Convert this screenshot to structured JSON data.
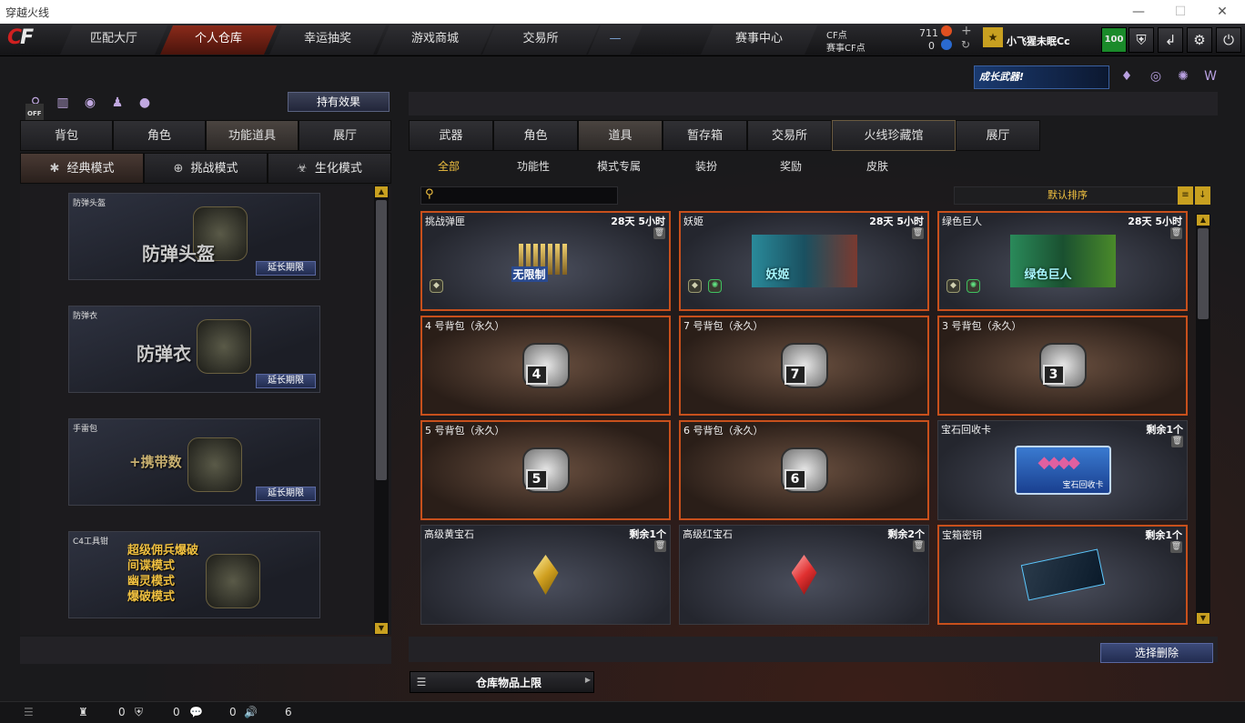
{
  "window": {
    "title": "穿越火线",
    "minimize": "—",
    "maximize": "☐",
    "close": "✕"
  },
  "nav": {
    "logo_a": "C",
    "logo_b": "F",
    "tabs": [
      {
        "label": "匹配大厅"
      },
      {
        "label": "个人仓库"
      },
      {
        "label": "幸运抽奖"
      },
      {
        "label": "游戏商城"
      },
      {
        "label": "交易所"
      },
      {
        "label": "—"
      },
      {
        "label": "赛事中心"
      }
    ],
    "cf_label": "CF点",
    "cf_value": "711",
    "match_cf_label": "赛事CF点",
    "match_cf_value": "0",
    "username": "小飞猩未眠Cc",
    "level": "100"
  },
  "left": {
    "effects_button": "持有效果",
    "off_badge": "OFF",
    "tabs": [
      {
        "label": "背包"
      },
      {
        "label": "角色"
      },
      {
        "label": "功能道具"
      },
      {
        "label": "展厅"
      }
    ],
    "modes": [
      {
        "label": "经典模式"
      },
      {
        "label": "挑战模式"
      },
      {
        "label": "生化模式"
      }
    ],
    "items": [
      {
        "name": "防弹头盔",
        "big": "防弹头盔",
        "action": "延长期限"
      },
      {
        "name": "防弹衣",
        "big": "防弹衣",
        "action": "延长期限"
      },
      {
        "name": "手雷包",
        "big": "+携带数",
        "action": "延长期限"
      },
      {
        "name": "C4工具钳",
        "lines": [
          "超级佣兵爆破",
          "间谍模式",
          "幽灵模式",
          "爆破模式"
        ]
      }
    ]
  },
  "right": {
    "banner": "成长武器!",
    "tabs": [
      {
        "label": "武器"
      },
      {
        "label": "角色"
      },
      {
        "label": "道具"
      },
      {
        "label": "暂存箱"
      },
      {
        "label": "交易所"
      },
      {
        "label": "火线珍藏馆"
      },
      {
        "label": "展厅"
      }
    ],
    "subtabs": [
      {
        "label": "全部"
      },
      {
        "label": "功能性"
      },
      {
        "label": "模式专属"
      },
      {
        "label": "装扮"
      },
      {
        "label": "奖励"
      },
      {
        "label": "皮肤"
      }
    ],
    "search_placeholder": "",
    "sort_label": "默认排序",
    "items": [
      {
        "name": "挑战弹匣",
        "meta": "28天 5小时",
        "label": "无限制"
      },
      {
        "name": "妖姬",
        "meta": "28天 5小时",
        "label": "妖姬"
      },
      {
        "name": "绿色巨人",
        "meta": "28天 5小时",
        "label": "绿色巨人"
      },
      {
        "name": "4 号背包（永久）",
        "meta": "",
        "num": "4"
      },
      {
        "name": "7 号背包（永久）",
        "meta": "",
        "num": "7"
      },
      {
        "name": "3 号背包（永久）",
        "meta": "",
        "num": "3"
      },
      {
        "name": "5 号背包（永久）",
        "meta": "",
        "num": "5"
      },
      {
        "name": "6 号背包（永久）",
        "meta": "",
        "num": "6"
      },
      {
        "name": "宝石回收卡",
        "meta": "剩余1个",
        "label": "宝石回收卡"
      },
      {
        "name": "高级黄宝石",
        "meta": "剩余1个"
      },
      {
        "name": "高级红宝石",
        "meta": "剩余2个"
      },
      {
        "name": "宝箱密钥",
        "meta": "剩余1个"
      }
    ],
    "delete_button": "选择删除",
    "capacity_label": "仓库物品上限"
  },
  "status": {
    "v1": "0",
    "v2": "0",
    "v3": "0",
    "v4": "6"
  },
  "colors": {
    "accent": "#f0c040",
    "active_tab": "#8a2a1a",
    "card_border": "#c8501c"
  }
}
